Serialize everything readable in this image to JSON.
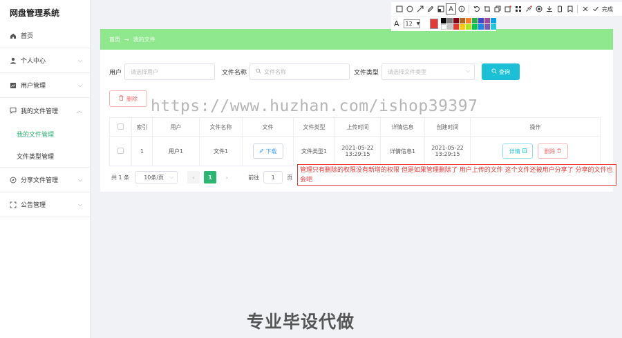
{
  "app_title": "网盘管理系统",
  "sidebar": {
    "items": [
      {
        "label": "首页",
        "icon": "home-icon"
      },
      {
        "label": "个人中心",
        "icon": "user-icon"
      },
      {
        "label": "用户管理",
        "icon": "user-manage-icon"
      },
      {
        "label": "我的文件管理",
        "icon": "chat-icon",
        "expanded": true,
        "children": [
          "我的文件管理",
          "文件类型管理"
        ]
      },
      {
        "label": "分享文件管理",
        "icon": "compass-icon"
      },
      {
        "label": "公告管理",
        "icon": "fullscreen-icon"
      }
    ]
  },
  "breadcrumb": {
    "home": "首页",
    "current": "我的文件"
  },
  "filters": {
    "user_label": "用户",
    "user_placeholder": "请选择用户",
    "filename_label": "文件名称",
    "filename_placeholder": "文件名称",
    "filetype_label": "文件类型",
    "filetype_placeholder": "请选择文件类型",
    "search_label": "查询"
  },
  "delete_label": "删除",
  "table": {
    "headers": [
      "索引",
      "用户",
      "文件名称",
      "文件",
      "文件类型",
      "上传时间",
      "详情信息",
      "创建时间",
      "操作"
    ],
    "rows": [
      {
        "index": "1",
        "user": "用户1",
        "filename": "文件1",
        "file_btn": "下载",
        "filetype": "文件类型1",
        "upload_time": "2021-05-22 13:29:15",
        "detail": "详情信息1",
        "create_time": "2021-05-22 13:29:15",
        "edit_label": "详情",
        "del_label": "删除"
      }
    ]
  },
  "pager": {
    "total": "共 1 条",
    "page_size": "10条/页",
    "current": "1",
    "goto_prefix": "前往",
    "goto_value": "1",
    "goto_suffix": "页"
  },
  "watermark": "https://www.huzhan.com/ishop39397",
  "annotation": "管理只有删除的权限没有新增的权限 但是如果管理删除了 用户上传的文件 这个文件还被用户分享了 分享的文件也会吧",
  "annotation_tool": {
    "font_size": "12",
    "done_label": "完成",
    "current_color": "#e53935"
  },
  "palette": [
    "#000000",
    "#7f7f7f",
    "#880015",
    "#b5651d",
    "#ff7f27",
    "#22b14c",
    "#3f48cc",
    "#a349a4",
    "#00a2e8",
    "#ffffff",
    "#c3c3c3",
    "#e53935",
    "#ffc90e",
    "#b5e61d",
    "#00c853",
    "#1e88e5",
    "#7e57c2",
    "#26c6da"
  ],
  "slogan": "专业毕设代做",
  "colors": {
    "accent": "#2bb673",
    "breadcrumb_bg": "#90e88e",
    "search_btn": "#1cc0d6",
    "danger": "#f56c6c"
  }
}
